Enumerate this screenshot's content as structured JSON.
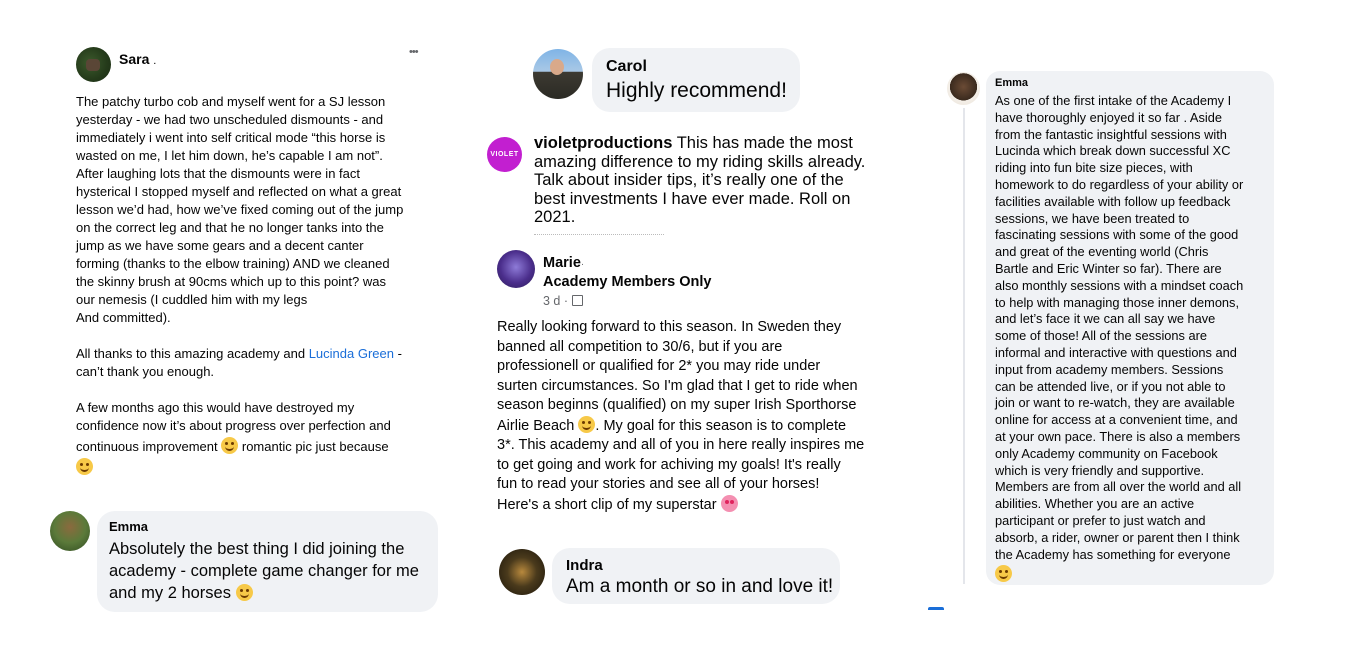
{
  "post": {
    "author": "Sara",
    "author_suffix": ".",
    "more": "•••",
    "lines": [
      "The patchy turbo cob and myself went for a SJ lesson",
      "yesterday - we had two unscheduled dismounts - and",
      "immediately i went into self critical mode “this horse is",
      "wasted on me, I let him down, he’s capable I am not”.",
      "After laughing lots that the dismounts were in fact",
      "hysterical I stopped myself and reflected on what a great",
      "lesson we’d had, how we’ve fixed coming out of the jump",
      "on the correct leg and that he no longer tanks into the",
      "jump as we have some gears and a decent canter",
      "forming (thanks to the elbow training) AND we cleaned",
      "the skinny brush at 90cms which up to this point?  was",
      "our nemesis (I cuddled him with my legs",
      "And committed)."
    ],
    "p2_before": "All thanks to this amazing academy and ",
    "p2_link": "Lucinda Green",
    "p2_after": " -",
    "p2_line2": "can’t thank you enough.",
    "p3_line1": "A few months ago this would have destroyed my",
    "p3_line2": "confidence now it’s about progress over perfection and",
    "p3_line3_a": "continuous improvement ",
    "p3_line3_b": " romantic pic just because"
  },
  "emma1": {
    "name": "Emma",
    "line1": "Absolutely the best thing I did joining the",
    "line2": "academy - complete game changer for me",
    "line3": "and my 2 horses "
  },
  "carol": {
    "name": "Carol",
    "text": "Highly recommend!"
  },
  "violet": {
    "avatar_text": "VIOLET",
    "name": "violetproductions",
    "line1": " This has made the most",
    "line2": "amazing difference to my riding skills already.",
    "line3": "Talk about insider  tips, it’s really one of the",
    "line4": "best investments I have ever made.  Roll on",
    "line5": "2021."
  },
  "marie": {
    "name": "Marie",
    "group": "Academy   Members Only",
    "meta": "3 d ·",
    "lines": [
      "Really looking forward to this season. In Sweden they",
      "banned all competition to 30/6, but if you are",
      "professionell or qualified for 2* you may ride under",
      "surten circumstances. So I'm glad that I get to ride when",
      "season beginns (qualified) on my super Irish Sporthorse"
    ],
    "line6_a": "Airlie Beach ",
    "line6_b": ". My goal for this season is to complete",
    "lines2": [
      "3*. This academy and all of you in here really inspires me",
      "to get going and work for achiving my goals! It's really",
      "fun to read your stories and see all of your horses!"
    ],
    "last": "Here's a short clip of my superstar "
  },
  "indra": {
    "name": "Indra",
    "text": "Am a month or so in and love it!"
  },
  "emma2": {
    "name": "Emma",
    "lines": [
      "As one of the first intake of the Academy I",
      "have thoroughly enjoyed it so far . Aside",
      "from the fantastic insightful sessions with",
      "Lucinda which break down successful XC",
      "riding into fun bite size pieces, with",
      "homework to do regardless of your ability or",
      "facilities available with follow up feedback",
      "sessions, we have been treated to",
      "fascinating sessions with some of the good",
      "and great of the eventing world (Chris",
      "Bartle and Eric Winter so far). There are",
      "also monthly sessions with a mindset coach",
      "to help with managing those inner demons,",
      "and let’s face it we can all say we have",
      "some of those! All of the sessions are",
      "informal and interactive with questions and",
      "input from academy members.  Sessions",
      "can be attended live, or if you not able to",
      "join or want to re-watch, they are available",
      "online for access at a convenient time, and",
      "at your own pace. There is also a members",
      "only Academy community on Facebook",
      "which is very friendly and supportive.",
      "Members are from all over the world and all",
      "abilities. Whether you are an active",
      "participant or prefer to just watch and",
      "absorb, a rider, owner or parent then I think",
      "the Academy has something for everyone"
    ]
  },
  "colors": {
    "bubble": "#f0f2f5",
    "link": "#1a6ed8",
    "text": "#050505",
    "violet_avatar": "#c21fd0"
  },
  "icons": [
    "avatar-photo",
    "more-options-icon",
    "globe-icon",
    "grinning-face-emoji",
    "heart-eyes-emoji",
    "laughing-emoji",
    "star-struck-emoji",
    "hearts-emoji",
    "smiling-face-emoji"
  ]
}
